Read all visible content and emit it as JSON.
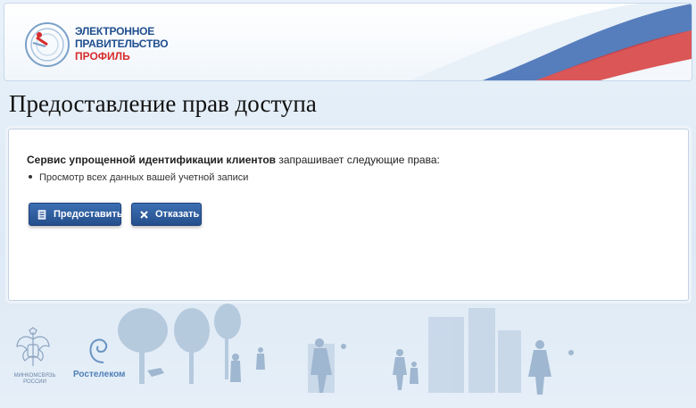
{
  "header": {
    "logo_line1": "ЭЛЕКТРОННОЕ",
    "logo_line2": "ПРАВИТЕЛЬСТВО",
    "logo_line3": "ПРОФИЛЬ"
  },
  "page": {
    "title": "Предоставление прав доступа"
  },
  "request": {
    "service_name": "Сервис упрощенной идентификации клиентов",
    "text": " запрашивает следующие права:",
    "permissions": [
      "Просмотр всех данных вашей учетной записи"
    ]
  },
  "buttons": {
    "grant_label": "Предоставить",
    "deny_label": "Отказать"
  },
  "footer": {
    "ministry_line1": "МИНКОМСВЯЗЬ",
    "ministry_line2": "РОССИИ",
    "partner": "Ростелеком"
  },
  "colors": {
    "brand_blue": "#1f4f8f",
    "brand_red": "#d62c2c",
    "button": "#2f5f9f"
  }
}
